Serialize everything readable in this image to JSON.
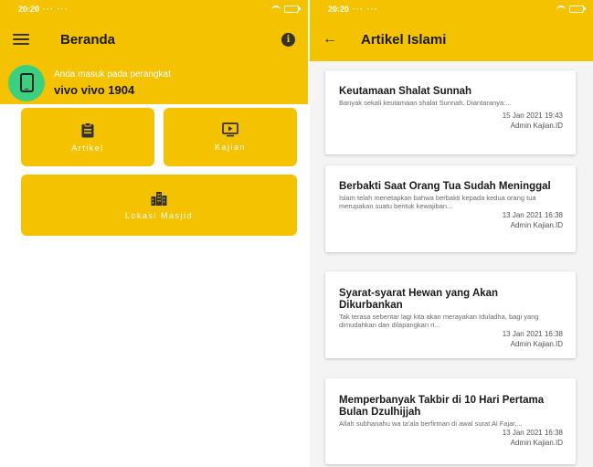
{
  "left_screen": {
    "status": {
      "time": "20:20",
      "extra": "··· ···"
    },
    "app_title": "Beranda",
    "info_label": "i",
    "device": {
      "caption": "Anda masuk pada perangkat",
      "name": "vivo vivo 1904"
    },
    "menu": [
      {
        "label": "Artikel",
        "icon": "clipboard-icon"
      },
      {
        "label": "Kajian",
        "icon": "video-play-icon"
      },
      {
        "label": "Lokasi Masjid",
        "icon": "city-buildings-icon"
      }
    ],
    "colors": {
      "primary": "#f5c200",
      "device_circle": "#3ccf7f",
      "text_dark": "#1a1a1a"
    }
  },
  "right_screen": {
    "status": {
      "time": "20:20",
      "extra": "··· ···"
    },
    "app_title": "Artikel Islami",
    "back_label": "←",
    "articles": [
      {
        "title": "Keutamaan Shalat Sunnah",
        "excerpt": "Banyak sekali keutamaan shalat Sunnah. Diantaranya:...",
        "date": "15 Jan 2021 19:43",
        "author": "Admin Kajian.ID"
      },
      {
        "title": "Berbakti Saat Orang Tua Sudah Meninggal",
        "excerpt": "Islam telah menetapkan bahwa berbakti kepada kedua orang tua merupakan suatu bentuk kewajiban...",
        "date": "13 Jan 2021 16:38",
        "author": "Admin Kajian.ID"
      },
      {
        "title": "Syarat-syarat Hewan yang Akan Dikurbankan",
        "excerpt": "Tak terasa sebentar lagi kita akan merayakan Iduladha, bagi yang dimudahkan dan dilapangkan ri...",
        "date": "13 Jan 2021 16:38",
        "author": "Admin Kajian.ID"
      },
      {
        "title": "Memperbanyak Takbir di 10 Hari Pertama Bulan Dzulhijjah",
        "excerpt": "Allah subhanahu wa ta'ala berfirman di awal surat Al Fajar,...",
        "date": "13 Jan 2021 16:38",
        "author": "Admin Kajian.ID"
      }
    ]
  }
}
